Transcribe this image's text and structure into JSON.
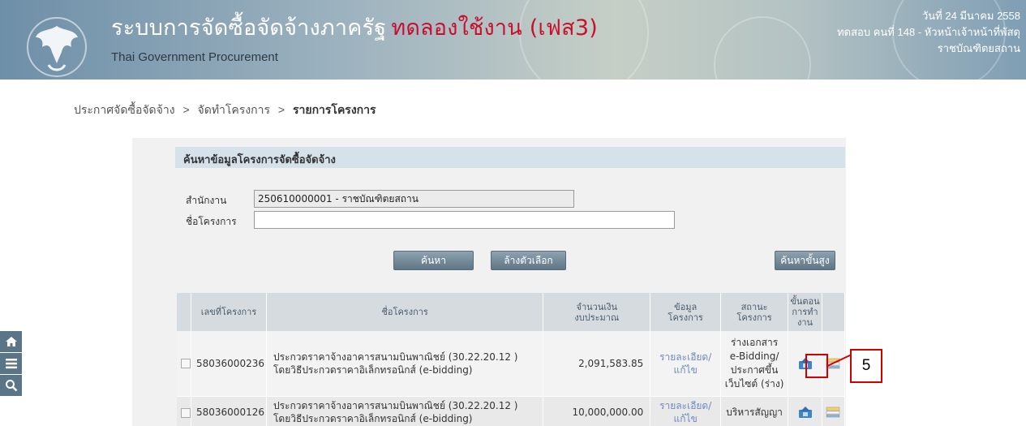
{
  "header": {
    "title_main": "ระบบการจัดซื้อจัดจ้างภาครัฐ",
    "title_trial": "ทดลองใช้งาน (เฟส3)",
    "subtitle": "Thai Government Procurement",
    "date": "วันที่ 24 มีนาคม 2558",
    "user": "ทดสอบ คนที่ 148 - หัวหน้าเจ้าหน้าที่พัสดุ",
    "agency": "ราชบัณฑิตยสถาน"
  },
  "breadcrumb": {
    "item1": "ประกาศจัดซื้อจัดจ้าง",
    "sep": ">",
    "item2": "จัดทำโครงการ",
    "item3": "รายการโครงการ"
  },
  "search": {
    "title": "ค้นหาข้อมูลโครงการจัดซื้อจัดจ้าง",
    "agency_label": "สำนักงาน",
    "agency_value": "250610000001 - ราชบัณฑิตยสถาน",
    "project_label": "ชื่อโครงการ",
    "project_value": "",
    "search_button": "ค้นหา",
    "clear_button": "ล้างตัวเลือก",
    "advanced_button": "ค้นหาขั้นสูง"
  },
  "table": {
    "headers": {
      "project_no": "เลขที่โครงการ",
      "project_name": "ชื่อโครงการ",
      "budget_1": "จำนวนเงิน",
      "budget_2": "งบประมาณ",
      "info_1": "ข้อมูล",
      "info_2": "โครงการ",
      "status_1": "สถานะ",
      "status_2": "โครงการ",
      "step_1": "ขั้นตอน",
      "step_2": "การทำ",
      "step_3": "งาน"
    },
    "rows": [
      {
        "number": "58036000236",
        "name_1": "ประกวดราคาจ้างอาคารสนามบินพาณิชย์ (30.22.20.12 )",
        "name_2": "โดยวิธีประกวดราคาอิเล็กทรอนิกส์ (e-bidding)",
        "amount": "2,091,583.85",
        "link_1": "รายละเอียด/",
        "link_2": "แก้ไข",
        "status_1": "ร่างเอกสาร",
        "status_2": "e-Bidding/",
        "status_3": "ประกาศขึ้น",
        "status_4": "เว็บไซต์ (ร่าง)"
      },
      {
        "number": "58036000126",
        "name_1": "ประกวดราคาจ้างอาคารสนามบินพาณิชย์ (30.22.20.12 )",
        "name_2": "โดยวิธีประกวดราคาอิเล็กทรอนิกส์ (e-bidding)",
        "amount": "10,000,000.00",
        "link_1": "รายละเอียด/",
        "link_2": "แก้ไข",
        "status_1": "บริหารสัญญา"
      }
    ]
  },
  "annotation": {
    "label": "5"
  },
  "icons": {
    "header_logo": "garuda-emblem-icon",
    "side": [
      "home-icon",
      "menu-icon",
      "search-icon"
    ],
    "step": "step-process-icon",
    "list": "list-icon"
  },
  "colors": {
    "trial_text": "#c8102e",
    "annotation": "#d40000",
    "link": "#6c8ac0"
  }
}
